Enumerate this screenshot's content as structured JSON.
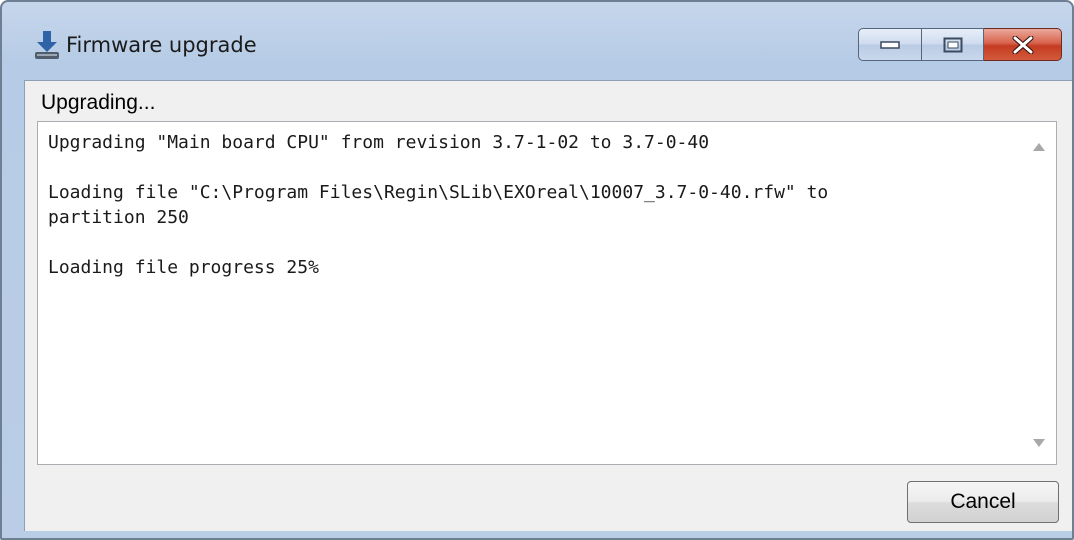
{
  "window": {
    "title": "Firmware upgrade",
    "icon": "download-arrow-icon",
    "controls": {
      "minimize_icon": "minimize-icon",
      "maximize_icon": "maximize-icon",
      "close_icon": "close-icon"
    }
  },
  "status": {
    "label": "Upgrading..."
  },
  "log": {
    "text": "Upgrading \"Main board CPU\" from revision 3.7-1-02 to 3.7-0-40\n\nLoading file \"C:\\Program Files\\Regin\\SLib\\EXOreal\\10007_3.7-0-40.rfw\" to\npartition 250\n\nLoading file progress 25%"
  },
  "buttons": {
    "cancel": "Cancel"
  },
  "colors": {
    "title_bar": "#b9cde6",
    "close_button": "#c8432a",
    "client_background": "#f0f0f0"
  }
}
